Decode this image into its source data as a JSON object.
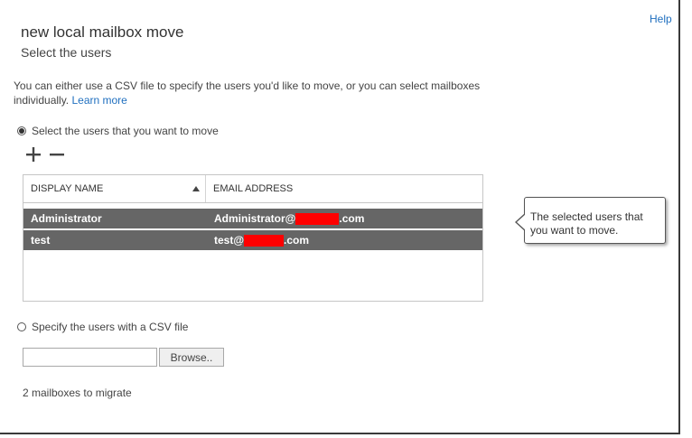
{
  "header": {
    "help_link": "Help",
    "title": "new local mailbox move",
    "subtitle": "Select the users"
  },
  "intro": {
    "text": "You can either use a CSV file to specify the users you'd like to move, or you can select mailboxes individually. ",
    "learn_more": "Learn more"
  },
  "option_select": {
    "label": "Select the users that you want to move",
    "selected": true
  },
  "toolbar": {
    "add_icon": "plus-icon",
    "remove_icon": "minus-icon"
  },
  "grid": {
    "columns": [
      {
        "label": "DISPLAY NAME",
        "sort": "ascending"
      },
      {
        "label": "EMAIL ADDRESS"
      }
    ],
    "rows": [
      {
        "display_name": "Administrator",
        "email_prefix": "Administrator@",
        "email_suffix": ".com"
      },
      {
        "display_name": "test",
        "email_prefix": "test@",
        "email_suffix": ".com"
      }
    ]
  },
  "tooltip": {
    "text": "The selected users that you want to move."
  },
  "option_csv": {
    "label": "Specify the users with a CSV file",
    "selected": false
  },
  "csv": {
    "value": "",
    "browse_label": "Browse.."
  },
  "footer": {
    "mailbox_count": "2 mailboxes to migrate"
  },
  "colors": {
    "link": "#1f6fbf",
    "selected_row": "#666666",
    "redaction": "#ff0000"
  }
}
